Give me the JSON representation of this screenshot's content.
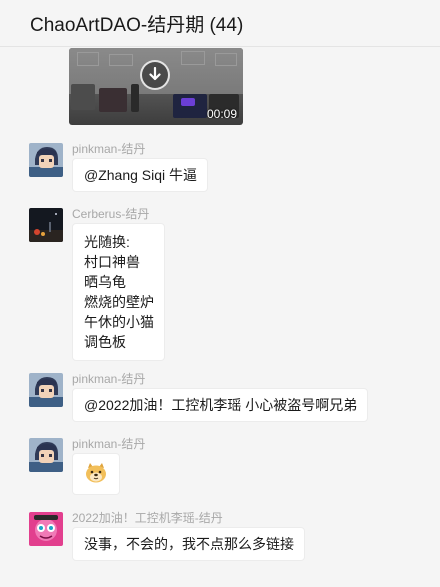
{
  "header": {
    "title": "ChaoArtDAO-结丹期 (44)"
  },
  "video": {
    "duration": "00:09",
    "icon": "download-icon"
  },
  "messages": [
    {
      "sender": "pinkman-结丹",
      "text": "@Zhang Siqi 牛逼",
      "avatar": "anime-boy-avatar"
    },
    {
      "sender": "Cerberus-结丹",
      "lines": [
        "光随换:",
        "村口神兽",
        "晒乌龟",
        "燃烧的壁炉",
        "午休的小猫",
        "调色板"
      ],
      "avatar": "night-scene-avatar"
    },
    {
      "sender": "pinkman-结丹",
      "text": "@2022加油！工控机李瑶 小心被盗号啊兄弟",
      "avatar": "anime-boy-avatar"
    },
    {
      "sender": "pinkman-结丹",
      "emoji": "doge-face-emoji",
      "avatar": "anime-boy-avatar"
    },
    {
      "sender": "2022加油！工控机李瑶-结丹",
      "text": "没事，不会的，我不点那么多链接",
      "avatar": "pink-character-avatar"
    }
  ]
}
